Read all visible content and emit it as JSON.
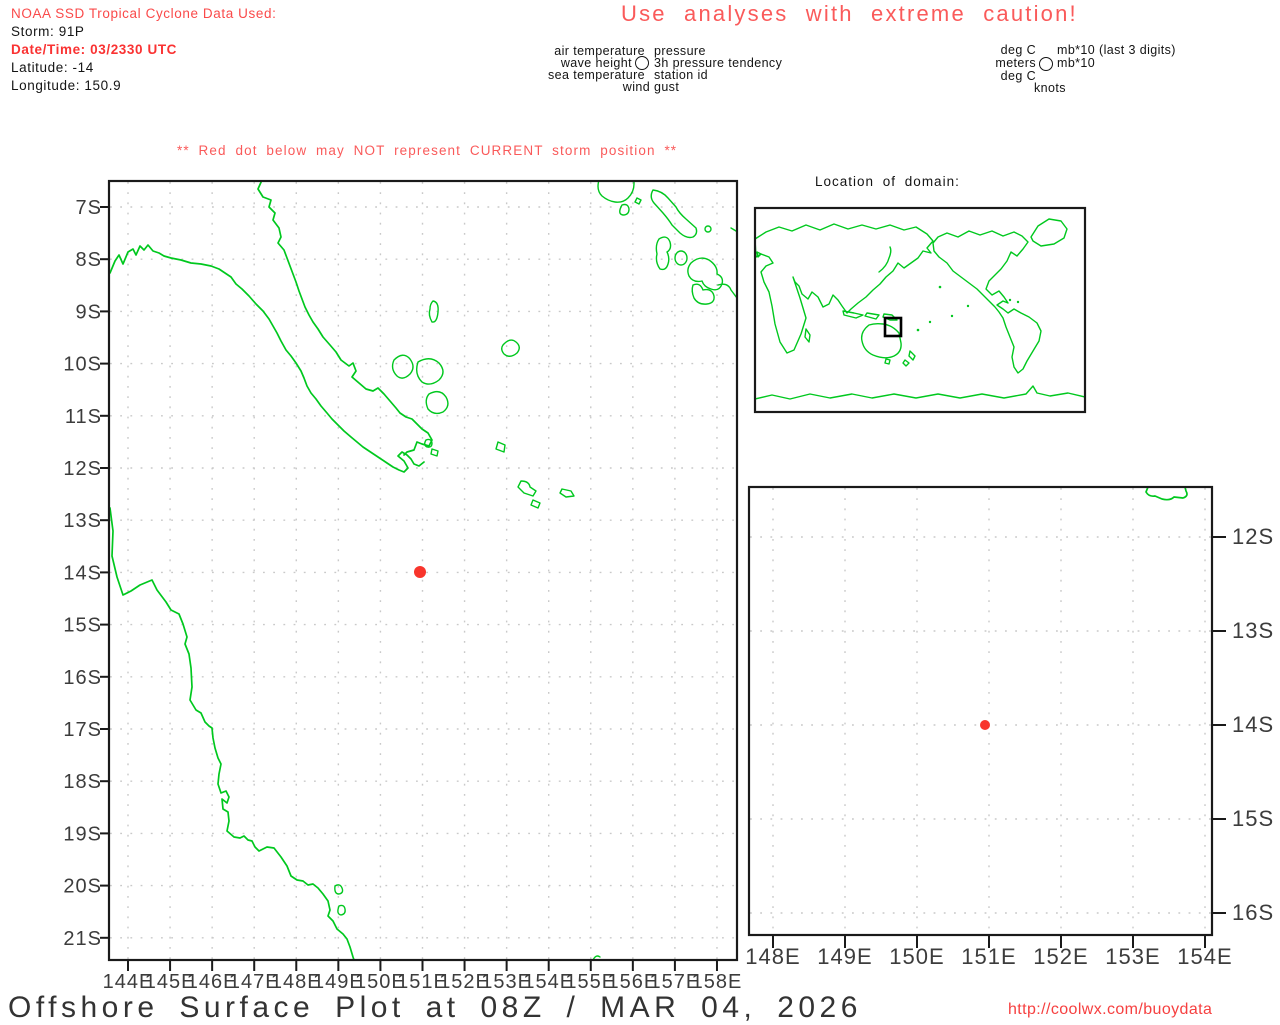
{
  "colors": {
    "coast_green": "#00c81e",
    "storm_red": "#f8352c",
    "grid_gray": "#c9c9c9",
    "warning_red": "#fa5a5a",
    "header_red": "#fa4a4a",
    "date_red": "#fa3232",
    "title_gray": "#333333",
    "url_red": "#f64040"
  },
  "header": {
    "source_line": "NOAA SSD Tropical Cyclone Data Used:",
    "storm_line": "Storm: 91P",
    "datetime_line": "Date/Time: 03/2330 UTC",
    "latitude_line": "Latitude: -14",
    "longitude_line": "Longitude: 150.9",
    "caution": "Use analyses with extreme caution!"
  },
  "station_legend": {
    "air_temperature": "air temperature",
    "wave_height": "wave height",
    "sea_temperature": "sea temperature",
    "wind_gust": "wind gust",
    "pressure": "pressure",
    "pressure_tendency": "3h pressure tendency",
    "station_id": "station id"
  },
  "units_legend": {
    "air_temp_units": "deg C",
    "wave_height_units": "meters",
    "sea_temp_units": "deg C",
    "wind_gust_units": "knots",
    "pressure_units": "mb*10 (last 3 digits)",
    "tendency_units": "mb*10"
  },
  "storm_warning": "** Red dot below may NOT represent CURRENT storm position **",
  "inset_title": "Location of domain:",
  "footer": {
    "title": "Offshore Surface Plot at 08Z / MAR 04, 2026",
    "url": "http://coolwx.com/buoydata"
  },
  "chart_data": {
    "type": "map",
    "main_map": {
      "lon_ticks": [
        "144E",
        "145E",
        "146E",
        "147E",
        "148E",
        "149E",
        "150E",
        "151E",
        "152E",
        "153E",
        "154E",
        "155E",
        "156E",
        "157E",
        "158E"
      ],
      "lat_ticks": [
        "7S",
        "8S",
        "9S",
        "10S",
        "11S",
        "12S",
        "13S",
        "14S",
        "15S",
        "16S",
        "17S",
        "18S",
        "19S",
        "20S",
        "21S"
      ],
      "storm_position": {
        "lon": 150.9,
        "lat": -14
      }
    },
    "zoom_map": {
      "lon_ticks": [
        "148E",
        "149E",
        "150E",
        "151E",
        "152E",
        "153E",
        "154E"
      ],
      "lat_ticks": [
        "12S",
        "13S",
        "14S",
        "15S",
        "16S"
      ],
      "storm_position": {
        "lon": 150.9,
        "lat": -14
      }
    }
  }
}
